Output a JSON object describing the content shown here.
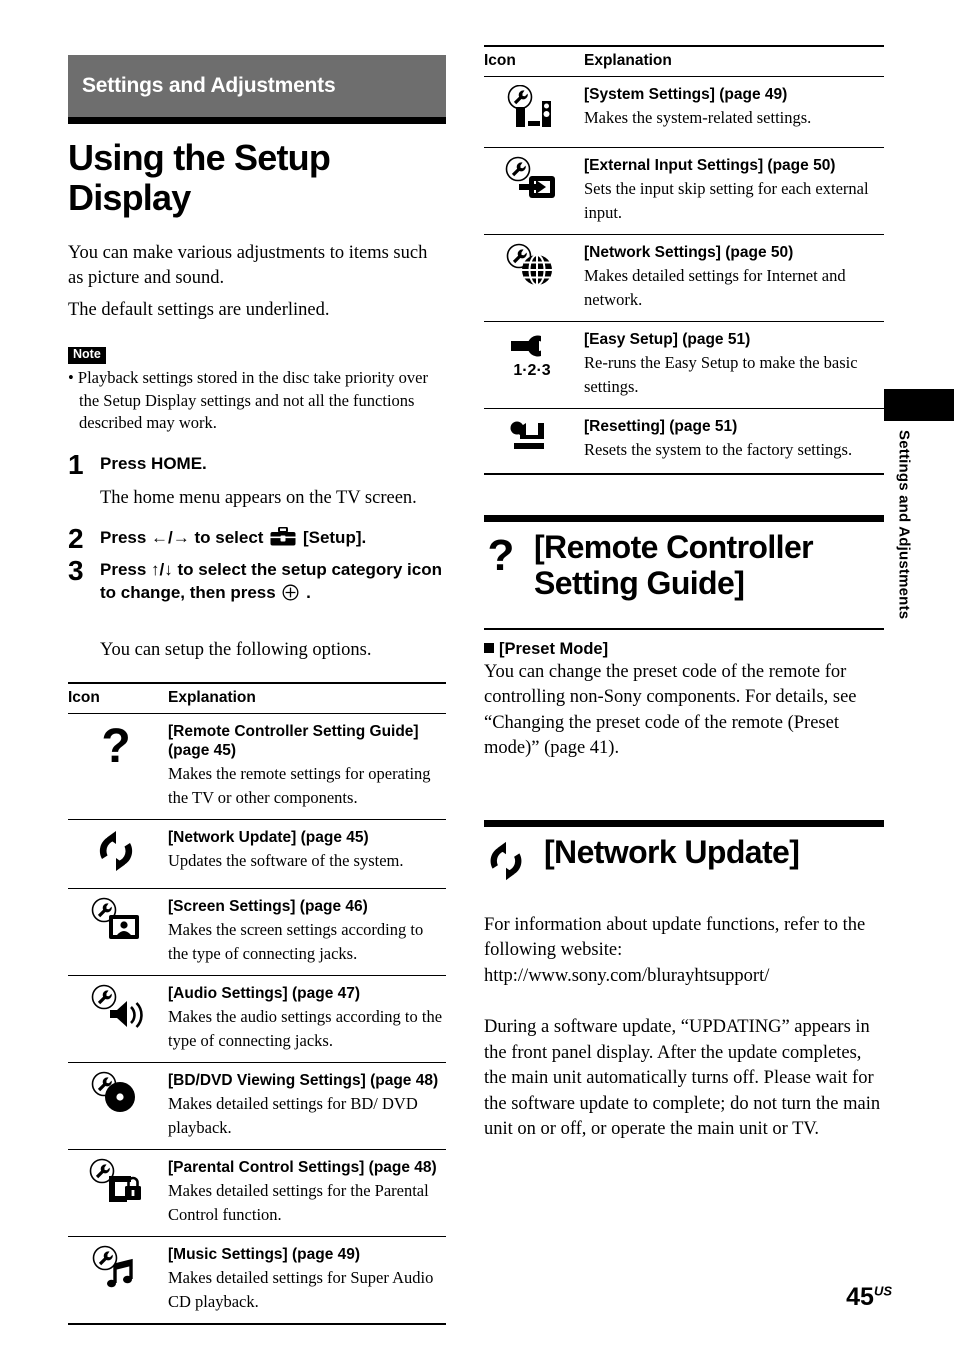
{
  "banner": {
    "chapter": "Settings and Adjustments"
  },
  "title": "Using the Setup Display",
  "intro": {
    "line1": "You can make various adjustments to items such as picture and sound.",
    "line2": "The default settings are underlined."
  },
  "note": {
    "label": "Note",
    "text": "• Playback settings stored in the disc take priority over the Setup Display settings and not all the functions described may work."
  },
  "steps": [
    {
      "num": "1",
      "head": "Press HOME.",
      "sub": "The home menu appears on the TV screen."
    },
    {
      "num": "2",
      "head_before": "Press ←/→ to select",
      "head_after": "[Setup].",
      "icon": "toolbox-icon"
    },
    {
      "num": "3",
      "head_before": "Press ↑/↓ to select the setup category icon to change, then press",
      "head_after": ".",
      "icon": "enter-button-icon"
    }
  ],
  "follow_note": "You can setup the following options.",
  "table": {
    "headers": {
      "icon": "Icon",
      "explanation": "Explanation"
    },
    "left_rows": [
      {
        "icon": "question-mark-icon",
        "title": "[Remote Controller Setting Guide] (page 45)",
        "desc": "Makes the remote settings for operating the TV or other components."
      },
      {
        "icon": "network-update-icon",
        "title": "[Network Update] (page 45)",
        "desc": "Updates the software of the system."
      },
      {
        "icon": "screen-settings-icon",
        "title": "[Screen Settings] (page 46)",
        "desc": "Makes the screen settings according to the type of connecting jacks."
      },
      {
        "icon": "audio-settings-icon",
        "title": "[Audio Settings] (page 47)",
        "desc": "Makes the audio settings according to the type of connecting jacks."
      },
      {
        "icon": "bd-dvd-viewing-settings-icon",
        "title": "[BD/DVD Viewing Settings] (page 48)",
        "desc": "Makes detailed settings for BD/ DVD playback."
      },
      {
        "icon": "parental-control-settings-icon",
        "title": "[Parental Control Settings] (page 48)",
        "desc": "Makes detailed settings for the Parental Control function."
      },
      {
        "icon": "music-settings-icon",
        "title": "[Music Settings] (page 49)",
        "desc": "Makes detailed settings for Super Audio CD playback."
      }
    ],
    "right_rows": [
      {
        "icon": "system-settings-icon",
        "title": "[System Settings] (page 49)",
        "desc": "Makes the system-related settings."
      },
      {
        "icon": "external-input-settings-icon",
        "title": "[External Input Settings] (page 50)",
        "desc": "Sets the input skip setting for each external input."
      },
      {
        "icon": "network-settings-icon",
        "title": "[Network Settings] (page 50)",
        "desc": "Makes detailed settings for Internet and network."
      },
      {
        "icon": "easy-setup-icon",
        "title": "[Easy Setup] (page 51)",
        "desc": "Re-runs the Easy Setup to make the basic settings."
      },
      {
        "icon": "resetting-icon",
        "title": "[Resetting] (page 51)",
        "desc": "Resets the system to the factory settings."
      }
    ]
  },
  "section_remote": {
    "icon": "question-mark-icon",
    "title": "[Remote Controller Setting Guide]",
    "sub_head": "[Preset Mode]",
    "body": "You can change the preset code of the remote for controlling non-Sony components. For details, see “Changing the preset code of the remote (Preset mode)” (page 41)."
  },
  "section_network": {
    "icon": "network-update-icon",
    "title": "[Network Update]",
    "body1": "For information about update functions, refer to the following website: http://www.sony.com/blurayhtsupport/",
    "body2": "During a software update, “UPDATING” appears in the front panel display. After the update completes, the main unit automatically turns off. Please wait for the software update to complete; do not turn the main unit on or off, or operate the main unit or TV."
  },
  "side_tab": {
    "label": "Settings and Adjustments"
  },
  "folio": {
    "number": "45",
    "region": "US"
  }
}
